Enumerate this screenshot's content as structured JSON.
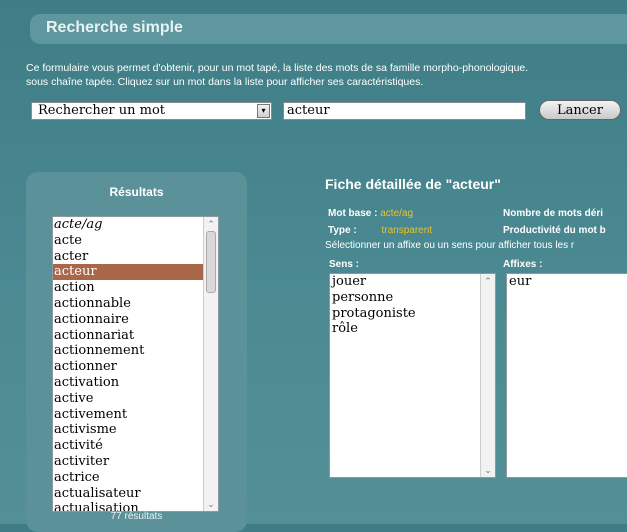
{
  "header": {
    "title": "Recherche simple"
  },
  "intro": {
    "line1": "Ce formulaire vous permet d'obtenir, pour un mot tapé, la liste des mots de sa famille morpho-phonologique.",
    "line2": "sous chaîne tapée. Cliquez sur un mot dans la liste pour afficher ses caractéristiques."
  },
  "search": {
    "mode": "Rechercher un mot",
    "mode_arrow": "▾",
    "word": "acteur",
    "button": "Lancer"
  },
  "results": {
    "title": "Résultats",
    "items": [
      {
        "label": "acte/ag"
      },
      {
        "label": "acte"
      },
      {
        "label": "acter"
      },
      {
        "label": "acteur"
      },
      {
        "label": "action"
      },
      {
        "label": "actionnable"
      },
      {
        "label": "actionnaire"
      },
      {
        "label": "actionnariat"
      },
      {
        "label": "actionnement"
      },
      {
        "label": "actionner"
      },
      {
        "label": "activation"
      },
      {
        "label": "active"
      },
      {
        "label": "activement"
      },
      {
        "label": "activisme"
      },
      {
        "label": "activité"
      },
      {
        "label": "activiter"
      },
      {
        "label": "actrice"
      },
      {
        "label": "actualisateur"
      },
      {
        "label": "actualisation"
      }
    ],
    "count": "77 résultats",
    "scroll_up": "⌃",
    "scroll_down": "⌄"
  },
  "detail": {
    "title": "Fiche détaillée de \"acteur\"",
    "base_label": "Mot base :",
    "base_value": "acte/ag",
    "type_label": "Type :",
    "type_value": "transparent",
    "family_size_label": "Nombre de mots déri",
    "productivity_label": "Productivité du mot b",
    "hint": "Sélectionner un affixe ou un sens pour afficher tous les r",
    "meanings_label": "Sens :",
    "affixes_label": "Affixes :",
    "meanings": [
      {
        "label": "jouer"
      },
      {
        "label": "personne"
      },
      {
        "label": "protagoniste"
      },
      {
        "label": "rôle"
      }
    ],
    "affixes": [
      {
        "label": "eur"
      }
    ]
  },
  "colors": {
    "selected": "#a9674a",
    "value": "#e8c22e"
  }
}
